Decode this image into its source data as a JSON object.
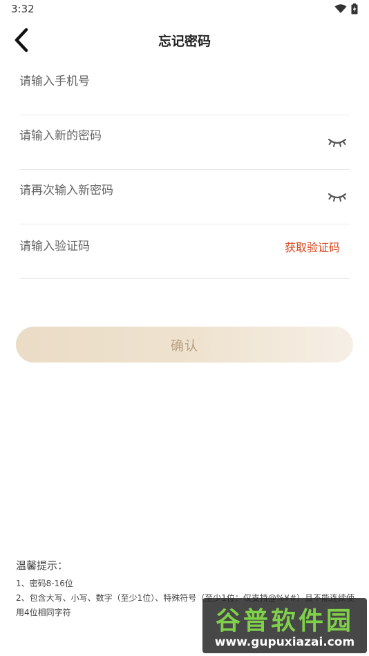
{
  "status_bar": {
    "time": "3:32",
    "icons": [
      "wifi-icon",
      "battery-charging-icon"
    ]
  },
  "header": {
    "title": "忘记密码",
    "back_icon": "chevron-left-icon"
  },
  "form": {
    "phone_placeholder": "请输入手机号",
    "new_password_placeholder": "请输入新的密码",
    "confirm_password_placeholder": "请再次输入新密码",
    "code_placeholder": "请输入验证码",
    "get_code_label": "获取验证码",
    "eye_icon": "eye-closed-icon"
  },
  "confirm_button": {
    "label": "确认"
  },
  "tips": {
    "title": "温馨提示：",
    "items": [
      "1、密码8-16位",
      "2、包含大写、小写、数字（至少1位）、特殊符号（至少1位：仅支持@%¥#）且不能连续使用4位相同字符"
    ]
  },
  "watermark": {
    "title": "谷普软件园",
    "url": "www.gupuxiazai.com"
  },
  "colors": {
    "accent": "#d9491f",
    "button_bg": "#efe3d0",
    "button_text": "#b8a184",
    "divider": "#e8e8e8"
  }
}
